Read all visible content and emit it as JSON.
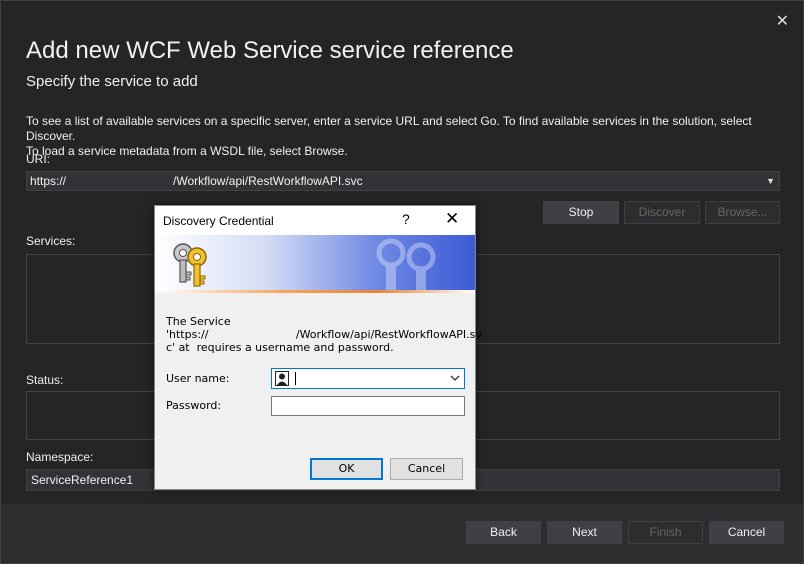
{
  "window": {
    "title": "Add new WCF Web Service service reference",
    "subtitle": "Specify the service to add",
    "close_glyph": "✕",
    "description_lines": [
      "To see a list of available services on a specific server, enter a service URL and select Go. To find available services in the solution, select Discover.",
      "To load a service metadata from a WSDL file, select Browse."
    ]
  },
  "uri": {
    "label": "URI:",
    "prefix": "https://",
    "path": "/Workflow/api/RestWorkflowAPI.svc",
    "dropdown_glyph": "▼"
  },
  "actions": {
    "stop": "Stop",
    "discover": "Discover",
    "browse": "Browse..."
  },
  "services": {
    "label": "Services:"
  },
  "status": {
    "label": "Status:"
  },
  "namespace": {
    "label": "Namespace:",
    "value": "ServiceReference1"
  },
  "footer": {
    "back": "Back",
    "next": "Next",
    "finish": "Finish",
    "cancel": "Cancel"
  },
  "dialog": {
    "title": "Discovery Credential",
    "help_glyph": "?",
    "close_glyph": "✕",
    "message_lines": [
      "The Service",
      "'https://                         /Workflow/api/RestWorkflowAPI.sv",
      "c' at  requires a username and password."
    ],
    "username_label": "User name:",
    "username_value": "",
    "password_label": "Password:",
    "ok": "OK",
    "cancel": "Cancel"
  },
  "colors": {
    "background": "#252526",
    "footer": "#2d2d30",
    "button": "#3f3f46",
    "disabled_text": "#656565",
    "focus_blue": "#0078d7"
  },
  "icons": [
    "close-icon",
    "dropdown-arrow-icon",
    "keys-icon",
    "help-icon",
    "user-icon",
    "chevron-down-icon"
  ]
}
